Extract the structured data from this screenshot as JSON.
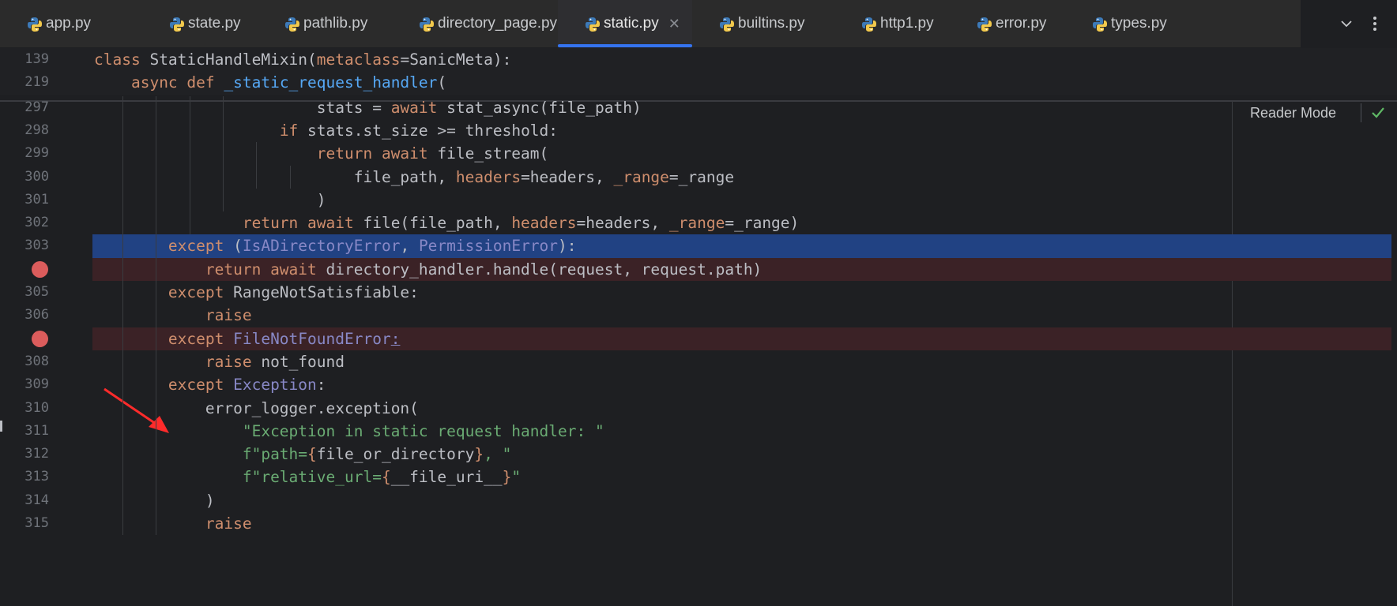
{
  "tabs": [
    {
      "label": "app.py",
      "active": false
    },
    {
      "label": "state.py",
      "active": false
    },
    {
      "label": "pathlib.py",
      "active": false
    },
    {
      "label": "directory_page.py",
      "active": false
    },
    {
      "label": "static.py",
      "active": true
    },
    {
      "label": "builtins.py",
      "active": false
    },
    {
      "label": "http1.py",
      "active": false
    },
    {
      "label": "error.py",
      "active": false
    },
    {
      "label": "types.py",
      "active": false
    }
  ],
  "editor": {
    "reader_mode_label": "Reader Mode",
    "sticky": [
      {
        "num": "139",
        "indent": "",
        "tokens": [
          [
            "kw",
            "class "
          ],
          [
            "cls",
            "StaticHandleMixin("
          ],
          [
            "param",
            "metaclass"
          ],
          [
            "",
            "=SanicMeta):"
          ]
        ]
      },
      {
        "num": "219",
        "indent": "    ",
        "tokens": [
          [
            "kw",
            "async def "
          ],
          [
            "fn",
            "_static_request_handler"
          ],
          [
            "",
            "("
          ]
        ]
      }
    ],
    "lines": [
      {
        "num": "297",
        "indent": "                        ",
        "tokens": [
          [
            "",
            "stats = "
          ],
          [
            "kw",
            "await "
          ],
          [
            "",
            "stat_async(file_path)"
          ]
        ]
      },
      {
        "num": "298",
        "indent": "                    ",
        "tokens": [
          [
            "kw",
            "if "
          ],
          [
            "",
            "stats.st_size >= threshold:"
          ]
        ]
      },
      {
        "num": "299",
        "indent": "                        ",
        "tokens": [
          [
            "kw",
            "return await "
          ],
          [
            "",
            "file_stream("
          ]
        ]
      },
      {
        "num": "300",
        "indent": "                            ",
        "tokens": [
          [
            "",
            "file_path, "
          ],
          [
            "param",
            "headers"
          ],
          [
            "",
            "=headers, "
          ],
          [
            "param",
            "_range"
          ],
          [
            "",
            "=_range"
          ]
        ]
      },
      {
        "num": "301",
        "indent": "                        ",
        "tokens": [
          [
            "",
            ")"
          ]
        ]
      },
      {
        "num": "302",
        "indent": "                ",
        "tokens": [
          [
            "kw",
            "return await "
          ],
          [
            "",
            "file(file_path, "
          ],
          [
            "param",
            "headers"
          ],
          [
            "",
            "=headers, "
          ],
          [
            "param",
            "_range"
          ],
          [
            "",
            "=_range)"
          ]
        ]
      },
      {
        "num": "303",
        "indent": "        ",
        "state": "selected",
        "tokens": [
          [
            "kw",
            "except "
          ],
          [
            "",
            "("
          ],
          [
            "builtin",
            "IsADirectoryError"
          ],
          [
            "",
            ", "
          ],
          [
            "builtin",
            "PermissionError"
          ],
          [
            "",
            "):"
          ]
        ]
      },
      {
        "num": "",
        "indent": "            ",
        "state": "bp",
        "tokens": [
          [
            "kw",
            "return await "
          ],
          [
            "",
            "directory_handler.handle(request, request.path)"
          ]
        ]
      },
      {
        "num": "305",
        "indent": "        ",
        "tokens": [
          [
            "kw",
            "except "
          ],
          [
            "",
            "RangeNotSatisfiable:"
          ]
        ]
      },
      {
        "num": "306",
        "indent": "            ",
        "tokens": [
          [
            "kw",
            "raise"
          ]
        ]
      },
      {
        "num": "",
        "indent": "        ",
        "state": "bp",
        "tokens": [
          [
            "kw",
            "except "
          ],
          [
            "builtin",
            "FileNotFoundError"
          ],
          [
            "ul",
            ":"
          ]
        ]
      },
      {
        "num": "308",
        "indent": "            ",
        "tokens": [
          [
            "kw",
            "raise "
          ],
          [
            "",
            "not_found"
          ]
        ]
      },
      {
        "num": "309",
        "indent": "        ",
        "tokens": [
          [
            "kw",
            "except "
          ],
          [
            "builtin",
            "Exception"
          ],
          [
            "",
            ":"
          ]
        ]
      },
      {
        "num": "310",
        "indent": "            ",
        "tokens": [
          [
            "",
            "error_logger.exception("
          ]
        ]
      },
      {
        "num": "311",
        "indent": "                ",
        "tokens": [
          [
            "str",
            "\"Exception in static request handler: \""
          ]
        ]
      },
      {
        "num": "312",
        "indent": "                ",
        "tokens": [
          [
            "str",
            "f\"path="
          ],
          [
            "brace",
            "{"
          ],
          [
            "",
            "file_or_directory"
          ],
          [
            "brace",
            "}"
          ],
          [
            "str",
            ", \""
          ]
        ]
      },
      {
        "num": "313",
        "indent": "                ",
        "tokens": [
          [
            "str",
            "f\"relative_url="
          ],
          [
            "brace",
            "{"
          ],
          [
            "",
            "__file_uri__"
          ],
          [
            "brace",
            "}"
          ],
          [
            "str",
            "\""
          ]
        ]
      },
      {
        "num": "314",
        "indent": "            ",
        "tokens": [
          [
            "",
            ")"
          ]
        ]
      },
      {
        "num": "315",
        "indent": "            ",
        "tokens": [
          [
            "kw",
            "raise"
          ]
        ]
      }
    ]
  }
}
